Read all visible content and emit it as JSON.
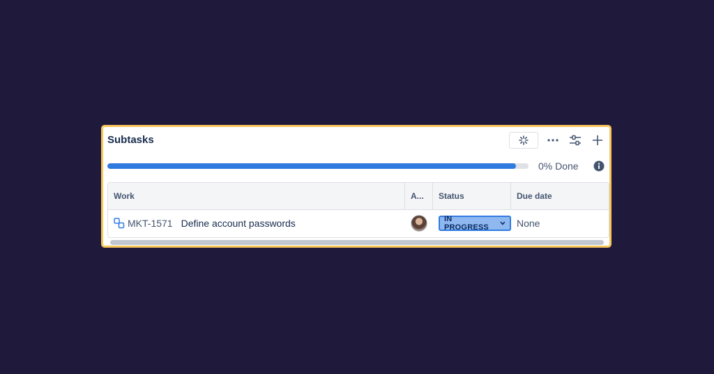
{
  "panel": {
    "title": "Subtasks",
    "toolbar": {
      "icons": [
        "loading-spinner-icon",
        "more-icon",
        "settings-sliders-icon",
        "plus-icon"
      ]
    },
    "progress": {
      "fraction": 0.97,
      "label": "0% Done"
    },
    "table": {
      "columns": [
        "Work",
        "A...",
        "Status",
        "Due date"
      ],
      "rows": [
        {
          "key": "MKT-1571",
          "summary": "Define account passwords",
          "assignee_icon": "avatar",
          "status": "IN PROGRESS",
          "due": "None"
        }
      ]
    }
  },
  "colors": {
    "background": "#1f193c",
    "panel_border": "#f7c65a",
    "progress": "#2f7be0",
    "status_bg": "#8fb8f0"
  }
}
